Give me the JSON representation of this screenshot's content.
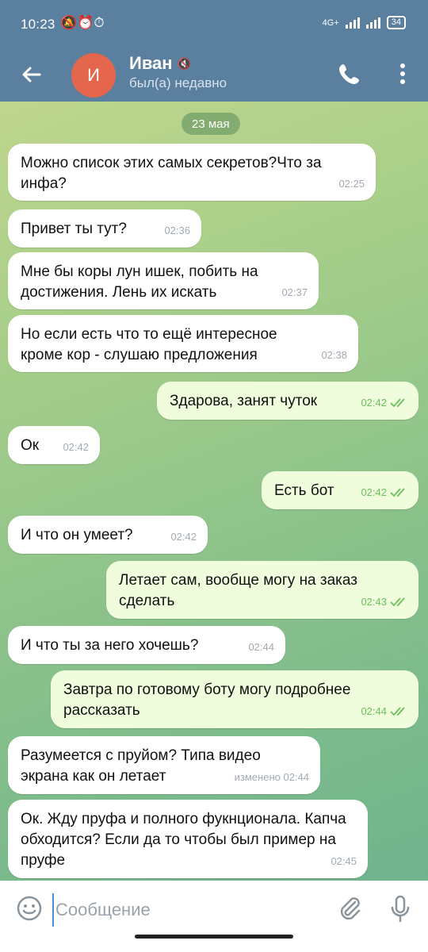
{
  "status_bar": {
    "time": "10:23",
    "icons": "🔕⏰⏱",
    "network": "4G+",
    "battery": "34"
  },
  "header": {
    "avatar_letter": "И",
    "name": "Иван",
    "status": "был(а) недавно"
  },
  "date_chip": "23 мая",
  "messages": [
    {
      "dir": "in",
      "text": "Можно список этих самых секретов?Что за инфа?",
      "time": "02:25"
    },
    {
      "dir": "in",
      "text": "Привет ты тут?",
      "time": "02:36"
    },
    {
      "dir": "in",
      "text": "Мне бы коры лун ишек, побить на достижения. Лень их искать",
      "time": "02:37"
    },
    {
      "dir": "in",
      "text": "Но если есть что то ещё интересное кроме кор - слушаю предложения",
      "time": "02:38"
    },
    {
      "dir": "out",
      "text": "Здарова, занят чуток",
      "time": "02:42",
      "read": true
    },
    {
      "dir": "in",
      "text": "Ок",
      "time": "02:42"
    },
    {
      "dir": "out",
      "text": "Есть бот",
      "time": "02:42",
      "read": true
    },
    {
      "dir": "in",
      "text": "И что он умеет?",
      "time": "02:42"
    },
    {
      "dir": "out",
      "text": "Летает сам, вообще могу на заказ сделать",
      "time": "02:43",
      "read": true
    },
    {
      "dir": "in",
      "text": "И что ты за него хочешь?",
      "time": "02:44"
    },
    {
      "dir": "out",
      "text": "Завтра по готовому боту могу подробнее рассказать",
      "time": "02:44",
      "read": true
    },
    {
      "dir": "in",
      "text": "Разумеется с пруйом? Типа видео экрана как он летает",
      "time": "изменено 02:44"
    },
    {
      "dir": "in",
      "text": "Ок. Жду пруфа и полного фукнционала. Капча обходится? Если да то чтобы был пример на пруфе",
      "time": "02:45"
    }
  ],
  "input": {
    "placeholder": "Сообщение",
    "value": ""
  },
  "colors": {
    "header": "#5a7f9f",
    "outgoing": "#effddd",
    "incoming": "#ffffff",
    "check": "#6cbf5a",
    "avatar": "#e4664d"
  }
}
